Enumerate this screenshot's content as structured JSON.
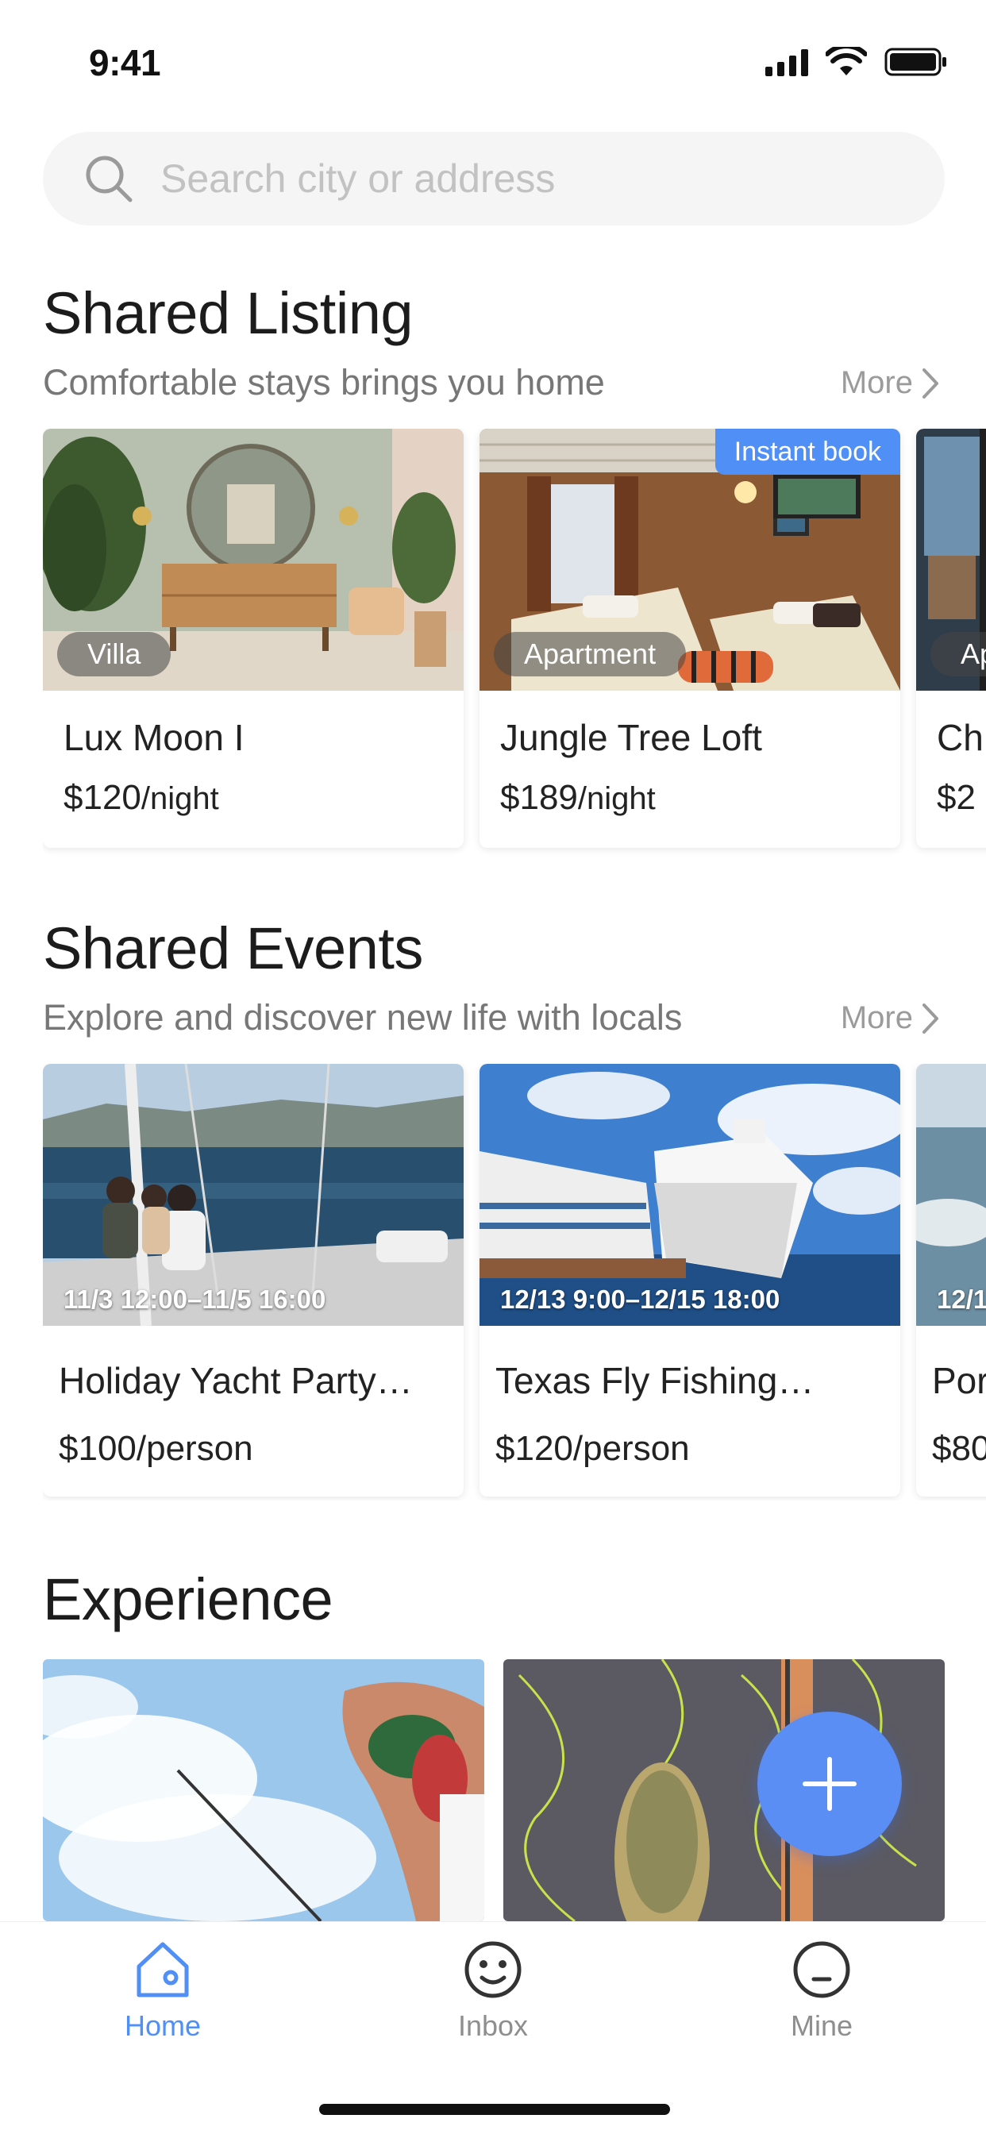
{
  "status": {
    "time": "9:41"
  },
  "search": {
    "placeholder": "Search city or address"
  },
  "listing": {
    "title": "Shared Listing",
    "subtitle": "Comfortable stays brings you home",
    "more": "More",
    "cards": [
      {
        "tag": "Villa",
        "title": "Lux Moon I",
        "price": "$120",
        "unit": "/night"
      },
      {
        "tag": "Apartment",
        "badge": "Instant book",
        "title": "Jungle Tree Loft",
        "price": "$189",
        "unit": "/night"
      },
      {
        "tag": "Ap",
        "title": "Ch",
        "price": "$2",
        "unit": ""
      }
    ]
  },
  "events": {
    "title": "Shared Events",
    "subtitle": "Explore and discover new life with locals",
    "more": "More",
    "cards": [
      {
        "date": "11/3 12:00–11/5 16:00",
        "title": "Holiday Yacht Party…",
        "price": "$100/person"
      },
      {
        "date": "12/13 9:00–12/15 18:00",
        "title": "Texas Fly Fishing…",
        "price": "$120/person"
      },
      {
        "date": "12/1",
        "title": "Por",
        "price": "$80"
      }
    ]
  },
  "experience": {
    "title": "Experience"
  },
  "tabs": [
    {
      "label": "Home",
      "icon": "home-icon",
      "active": true
    },
    {
      "label": "Inbox",
      "icon": "smile-icon",
      "active": false
    },
    {
      "label": "Mine",
      "icon": "user-icon",
      "active": false
    }
  ],
  "colors": {
    "accent": "#4f8ff6",
    "fab": "#5a8ef4"
  }
}
